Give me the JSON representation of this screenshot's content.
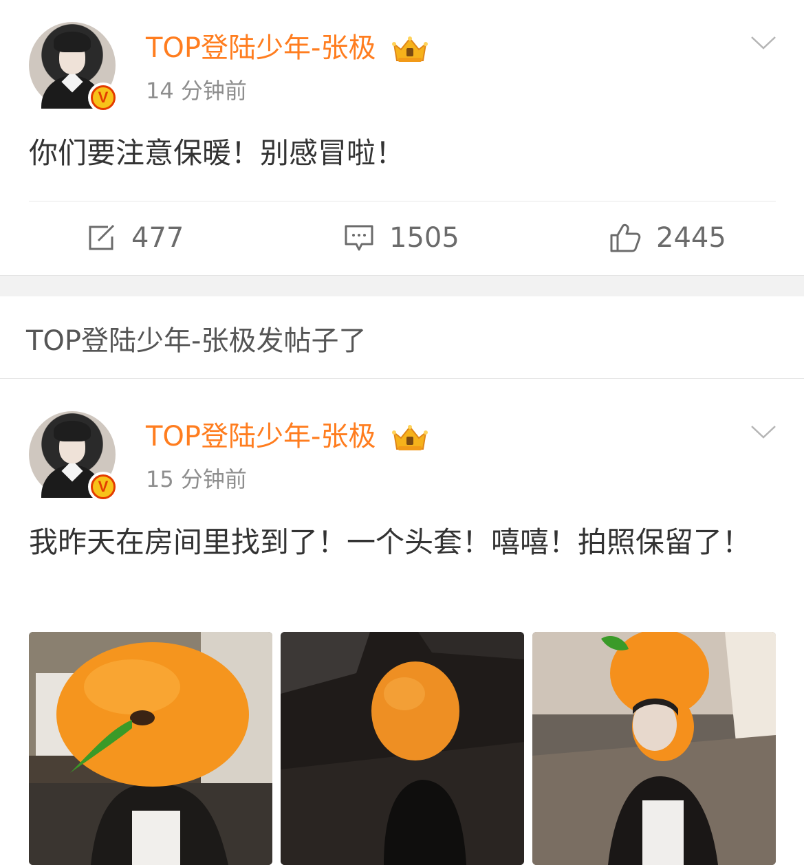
{
  "posts": [
    {
      "username": "TOP登陆少年-张极",
      "time": "14 分钟前",
      "text": "你们要注意保暖！别感冒啦！",
      "verified_badge": "V",
      "actions": {
        "repost": "477",
        "comment": "1505",
        "like": "2445"
      }
    },
    {
      "username": "TOP登陆少年-张极",
      "time": "15 分钟前",
      "text": "我昨天在房间里找到了！一个头套！嘻嘻！拍照保留了！",
      "verified_badge": "V"
    }
  ],
  "notice": "TOP登陆少年-张极发帖子了",
  "icons": {
    "repost": "repost-icon",
    "comment": "comment-icon",
    "like": "thumbs-up-icon",
    "more": "chevron-down-icon",
    "crown": "crown-badge-icon"
  },
  "colors": {
    "username": "#ff7d1f",
    "time": "#8e8e8e",
    "text": "#333333",
    "action": "#6b6b6b",
    "separator": "#f2f2f2",
    "badge_fill": "#f7c21a",
    "badge_ring": "#e33b00"
  }
}
